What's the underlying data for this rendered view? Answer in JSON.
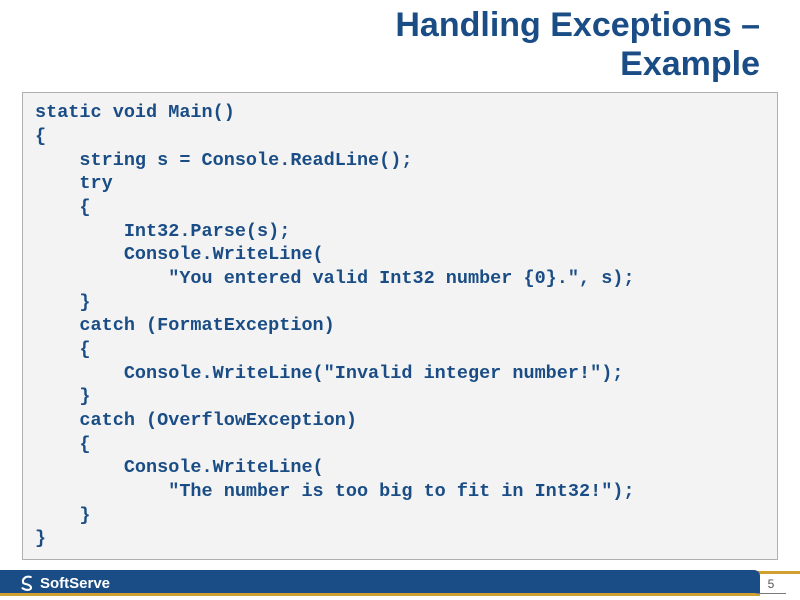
{
  "slide": {
    "title_line1": "Handling Exceptions –",
    "title_line2": "Example"
  },
  "code": {
    "lines": [
      "static void Main()",
      "{",
      "    string s = Console.ReadLine();",
      "    try",
      "    {",
      "        Int32.Parse(s);",
      "        Console.WriteLine(",
      "            \"You entered valid Int32 number {0}.\", s);",
      "    }",
      "    catch (FormatException)",
      "    {",
      "        Console.WriteLine(\"Invalid integer number!\");",
      "    }",
      "    catch (OverflowException)",
      "    {",
      "        Console.WriteLine(",
      "            \"The number is too big to fit in Int32!\");",
      "    }",
      "}"
    ]
  },
  "footer": {
    "brand": "SoftServe",
    "page_number": "5"
  },
  "colors": {
    "heading": "#1a4d85",
    "code_bg": "#f3f3f3",
    "footer_bg": "#1a4d85",
    "accent": "#d0a030"
  }
}
